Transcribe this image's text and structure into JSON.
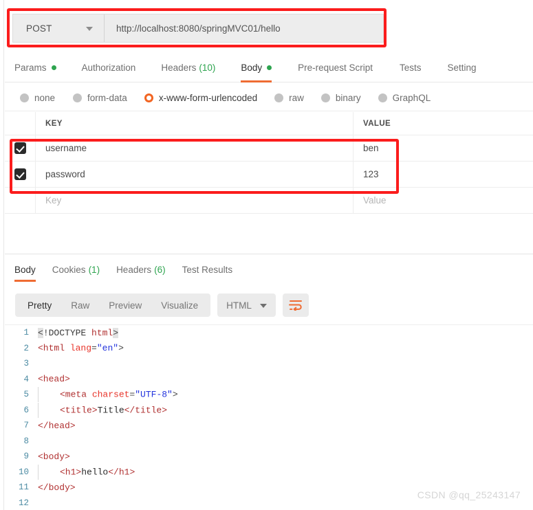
{
  "request": {
    "method": "POST",
    "url": "http://localhost:8080/springMVC01/hello",
    "tabs": [
      {
        "label": "Params",
        "dot": true,
        "count": ""
      },
      {
        "label": "Authorization",
        "dot": false,
        "count": ""
      },
      {
        "label": "Headers",
        "dot": false,
        "count": "(10)"
      },
      {
        "label": "Body",
        "dot": true,
        "count": ""
      },
      {
        "label": "Pre-request Script",
        "dot": false,
        "count": ""
      },
      {
        "label": "Tests",
        "dot": false,
        "count": ""
      },
      {
        "label": "Setting",
        "dot": false,
        "count": ""
      }
    ],
    "body_types": [
      "none",
      "form-data",
      "x-www-form-urlencoded",
      "raw",
      "binary",
      "GraphQL"
    ],
    "selected_body_type": "x-www-form-urlencoded",
    "table": {
      "headers": {
        "key": "KEY",
        "value": "VALUE"
      },
      "rows": [
        {
          "checked": true,
          "key": "username",
          "value": "ben"
        },
        {
          "checked": true,
          "key": "password",
          "value": "123"
        }
      ],
      "placeholder_row": {
        "key": "Key",
        "value": "Value"
      }
    }
  },
  "response": {
    "tabs": [
      {
        "label": "Body",
        "count": ""
      },
      {
        "label": "Cookies",
        "count": "(1)"
      },
      {
        "label": "Headers",
        "count": "(6)"
      },
      {
        "label": "Test Results",
        "count": ""
      }
    ],
    "viewer_modes": [
      "Pretty",
      "Raw",
      "Preview",
      "Visualize"
    ],
    "selected_viewer_mode": "Pretty",
    "format": "HTML",
    "code_lines": [
      {
        "n": "1",
        "segments": [
          {
            "t": "<",
            "c": "punc hl"
          },
          {
            "t": "!DOCTYPE ",
            "c": "doctype"
          },
          {
            "t": "html",
            "c": "tag"
          },
          {
            "t": ">",
            "c": "punc hl"
          }
        ]
      },
      {
        "n": "2",
        "segments": [
          {
            "t": "<html ",
            "c": "tag"
          },
          {
            "t": "lang",
            "c": "attr"
          },
          {
            "t": "=",
            "c": "punc"
          },
          {
            "t": "\"en\"",
            "c": "val"
          },
          {
            "t": ">",
            "c": "punc"
          }
        ]
      },
      {
        "n": "3",
        "segments": []
      },
      {
        "n": "4",
        "segments": [
          {
            "t": "<head>",
            "c": "tag"
          }
        ]
      },
      {
        "n": "5",
        "indent": 1,
        "segments": [
          {
            "t": "<meta ",
            "c": "tag"
          },
          {
            "t": "charset",
            "c": "attr"
          },
          {
            "t": "=",
            "c": "punc"
          },
          {
            "t": "\"UTF-8\"",
            "c": "val"
          },
          {
            "t": ">",
            "c": "punc"
          }
        ]
      },
      {
        "n": "6",
        "indent": 1,
        "segments": [
          {
            "t": "<title>",
            "c": "tag"
          },
          {
            "t": "Title",
            "c": "txt"
          },
          {
            "t": "</title>",
            "c": "tag"
          }
        ]
      },
      {
        "n": "7",
        "segments": [
          {
            "t": "</head>",
            "c": "tag"
          }
        ]
      },
      {
        "n": "8",
        "segments": []
      },
      {
        "n": "9",
        "segments": [
          {
            "t": "<body>",
            "c": "tag"
          }
        ]
      },
      {
        "n": "10",
        "indent": 1,
        "segments": [
          {
            "t": "<h1>",
            "c": "tag"
          },
          {
            "t": "hello",
            "c": "txt"
          },
          {
            "t": "</h1>",
            "c": "tag"
          }
        ]
      },
      {
        "n": "11",
        "segments": [
          {
            "t": "</body>",
            "c": "tag"
          }
        ]
      },
      {
        "n": "12",
        "segments": []
      }
    ]
  },
  "watermark": "CSDN @qq_25243147",
  "colors": {
    "accent": "#ef6c33",
    "annotation": "#fb1c1c",
    "status_dot": "#2ea44f",
    "radio_selected": "#f26522"
  }
}
